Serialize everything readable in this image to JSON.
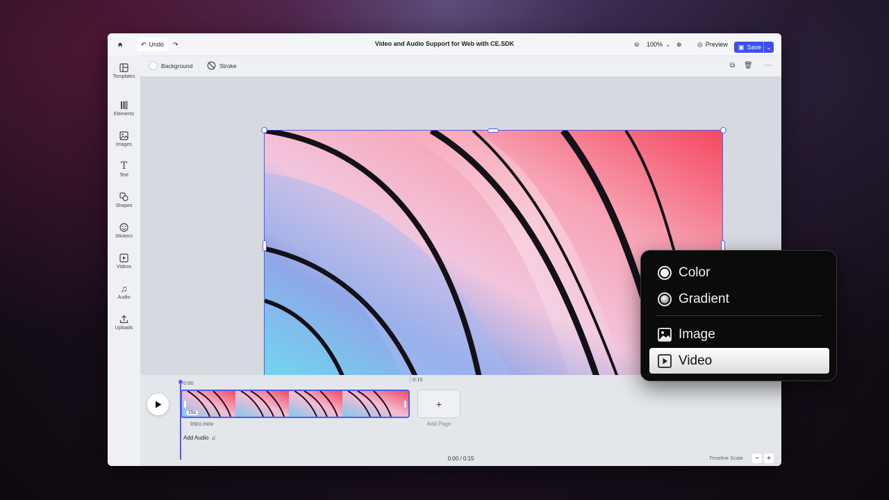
{
  "topbar": {
    "undo_label": "Undo",
    "title": "Video and Audio Support for Web with CE.SDK",
    "zoom": "100%",
    "preview_label": "Preview",
    "save_label": "Save"
  },
  "sidebar": {
    "items": [
      {
        "label": "Templates",
        "icon": "templates-icon"
      },
      {
        "label": "Elements",
        "icon": "elements-icon"
      },
      {
        "label": "Images",
        "icon": "image-icon"
      },
      {
        "label": "Text",
        "icon": "text-icon"
      },
      {
        "label": "Shapes",
        "icon": "shapes-icon"
      },
      {
        "label": "Stickers",
        "icon": "sticker-icon"
      },
      {
        "label": "Videos",
        "icon": "video-icon"
      },
      {
        "label": "Audio",
        "icon": "music-icon"
      },
      {
        "label": "Uploads",
        "icon": "upload-icon"
      }
    ]
  },
  "subbar": {
    "background_label": "Background",
    "stroke_label": "Stroke"
  },
  "timeline": {
    "start_time": "0:00",
    "marker_time": "0:15",
    "clip_duration": "15s",
    "clip_name": "Intro.mov",
    "add_audio_label": "Add Audio",
    "add_page_symbol": "+",
    "add_page_label": "Add Page",
    "time_readout": "0:00 / 0:15",
    "scale_label": "Timeline Scale",
    "scale_minus": "−",
    "scale_plus": "+"
  },
  "popup": {
    "items": [
      {
        "label": "Color",
        "kind": "radio"
      },
      {
        "label": "Gradient",
        "kind": "radio"
      },
      {
        "label": "Image",
        "kind": "image-icon"
      },
      {
        "label": "Video",
        "kind": "video-icon",
        "selected": true
      }
    ]
  },
  "colors": {
    "accent": "#4e5cf2",
    "save": "#3c4ff0"
  }
}
